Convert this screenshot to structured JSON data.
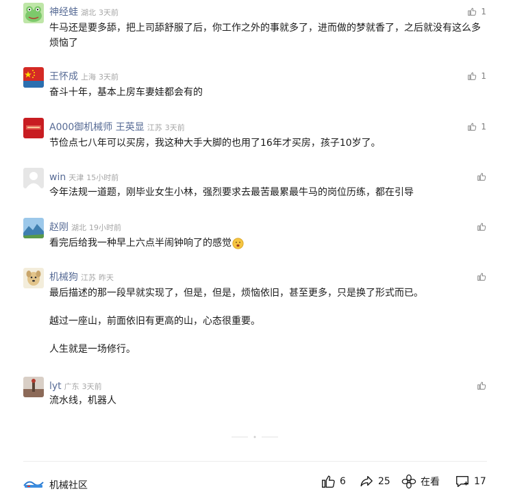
{
  "comments": [
    {
      "name": "神经蛙",
      "location": "湖北",
      "time": "3天前",
      "likes": "1",
      "text": [
        "牛马还是要多舔，把上司舔舒服了后，你工作之外的事就多了，进而做的梦就香了，之后就没有这么多烦恼了"
      ],
      "avatar_color": "#7dc96b"
    },
    {
      "name": "王怀成",
      "location": "上海",
      "time": "3天前",
      "likes": "1",
      "text": [
        "奋斗十年，基本上房车妻娃都会有的"
      ],
      "avatar_color": "#d42a25"
    },
    {
      "name": "A000御机械师 王英显",
      "location": "江苏",
      "time": "3天前",
      "likes": "1",
      "text": [
        "节俭点七八年可以买房，我这种大手大脚的也用了16年才买房，孩子10岁了。"
      ],
      "avatar_color": "#c81d22"
    },
    {
      "name": "win",
      "location": "天津",
      "time": "15小时前",
      "likes": "",
      "text": [
        "今年法规一道题，刚毕业女生小林，强烈要求去最苦最累最牛马的岗位历练，都在引导"
      ],
      "avatar_color": "#e6e6e6"
    },
    {
      "name": "赵刚",
      "location": "湖北",
      "time": "19小时前",
      "likes": "",
      "text": [
        "看完后给我一种早上六点半闹钟响了的感觉"
      ],
      "avatar_color": "#3f7fb0"
    },
    {
      "name": "机械狗",
      "location": "江苏",
      "time": "昨天",
      "likes": "",
      "text": [
        "最后描述的那一段早就实现了，但是，但是，烦恼依旧，甚至更多，只是换了形式而已。",
        "越过一座山，前面依旧有更高的山，心态很重要。",
        "人生就是一场修行。"
      ],
      "avatar_color": "#efe5c9"
    },
    {
      "name": "lyt",
      "location": "广东",
      "time": "3天前",
      "likes": "",
      "text": [
        "流水线，机器人"
      ],
      "avatar_color": "#8c6a58"
    }
  ],
  "footer": {
    "brand": "机械社区",
    "like_count": "6",
    "share_count": "25",
    "watch_label": "在看",
    "comment_count": "17"
  },
  "colors": {
    "name": "#576b95",
    "meta": "#a6a6a6",
    "text": "#1a1a1a"
  }
}
